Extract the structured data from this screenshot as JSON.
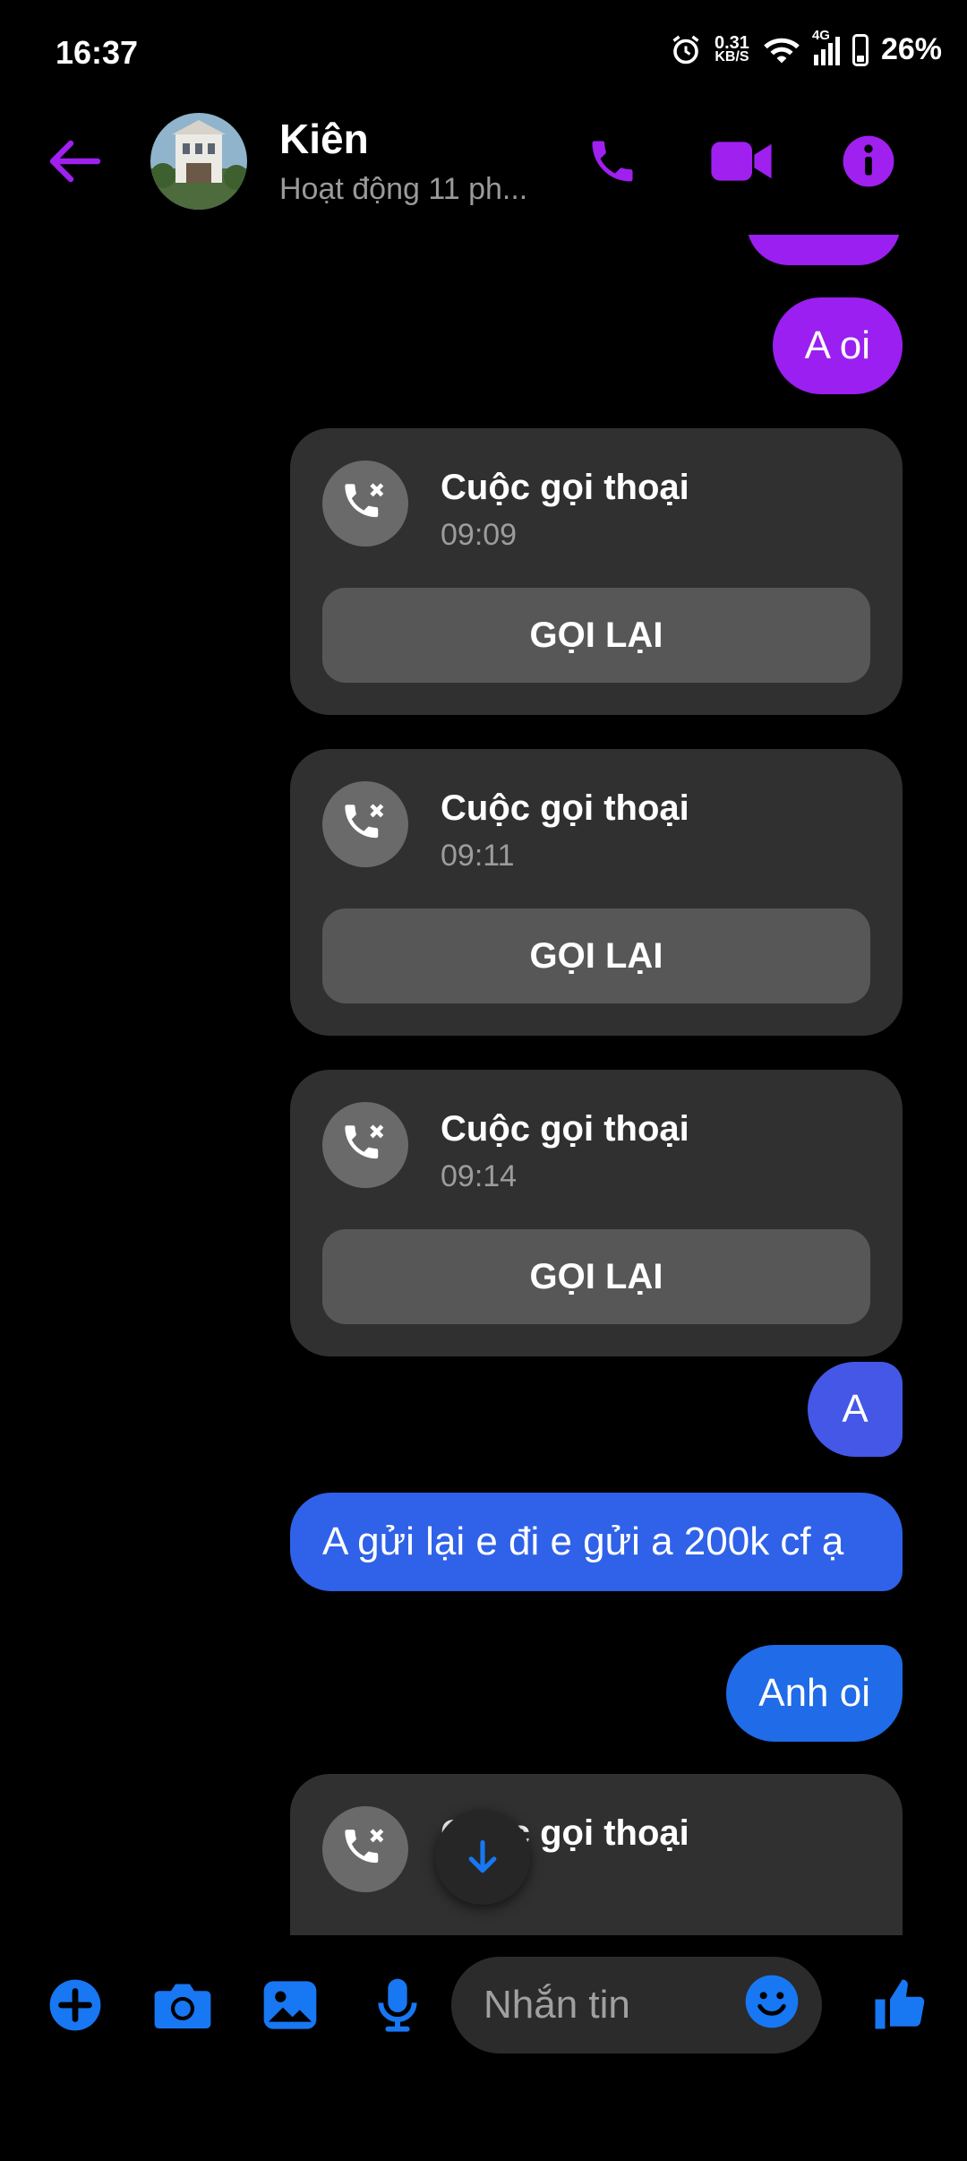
{
  "status_bar": {
    "time": "16:37",
    "net_speed_value": "0.31",
    "net_speed_unit": "KB/S",
    "network_type": "4G",
    "battery": "26%"
  },
  "header": {
    "contact_name": "Kiên",
    "contact_status": "Hoạt động 11 ph..."
  },
  "messages": [
    {
      "type": "text",
      "text": "A oi",
      "color": "#9b1ff0"
    },
    {
      "type": "call",
      "title": "Cuộc gọi thoại",
      "time": "09:09",
      "button": "GỌI LẠI"
    },
    {
      "type": "call",
      "title": "Cuộc gọi thoại",
      "time": "09:11",
      "button": "GỌI LẠI"
    },
    {
      "type": "call",
      "title": "Cuộc gọi thoại",
      "time": "09:14",
      "button": "GỌI LẠI"
    },
    {
      "type": "text",
      "text": "A",
      "color": "#4457e6"
    },
    {
      "type": "text",
      "text": "A gửi lại e đi e gửi a 200k cf ạ",
      "color": "#2f62e8"
    },
    {
      "type": "text",
      "text": "Anh oi",
      "color": "#1f6be8"
    },
    {
      "type": "call",
      "title": "Cuộc gọi thoại",
      "time": "",
      "button": ""
    }
  ],
  "composer": {
    "placeholder": "Nhắn tin"
  },
  "colors": {
    "accent_purple": "#a020f0",
    "accent_blue": "#1877f2",
    "background": "#000000",
    "call_card": "#303030"
  },
  "icons": [
    "back-arrow-icon",
    "phone-icon",
    "video-camera-icon",
    "info-icon",
    "missed-call-icon",
    "scroll-down-arrow-icon",
    "plus-icon",
    "camera-icon",
    "gallery-icon",
    "microphone-icon",
    "emoji-icon",
    "thumbs-up-icon"
  ]
}
